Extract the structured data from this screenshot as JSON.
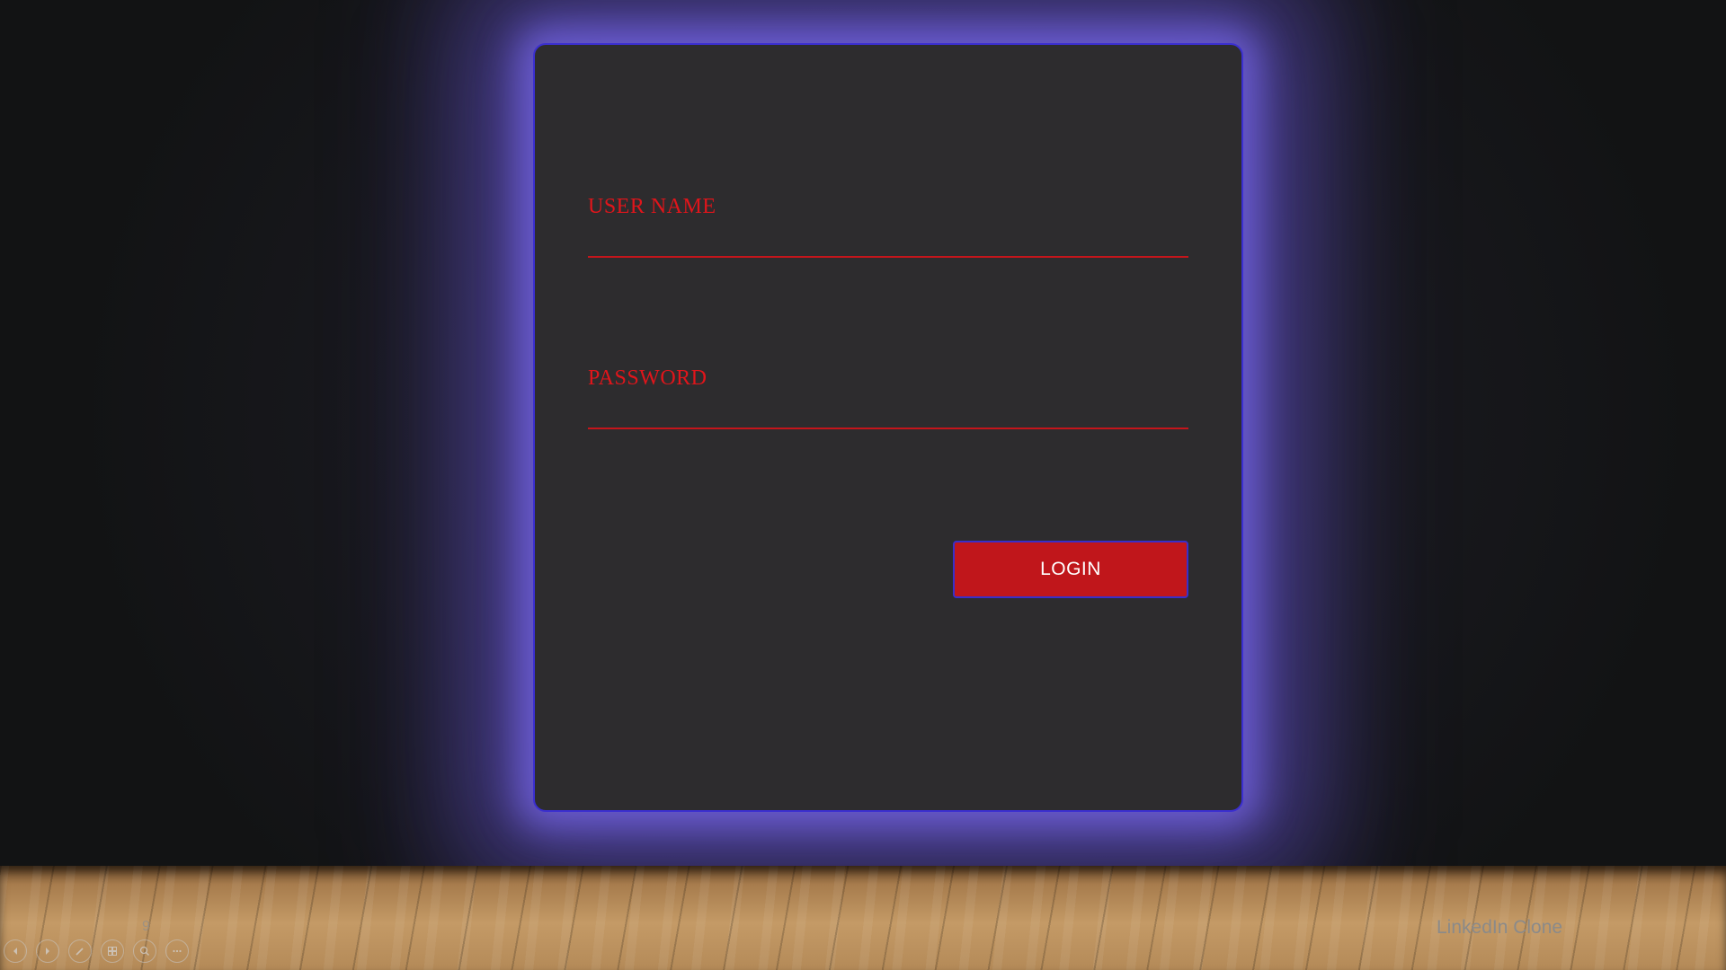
{
  "form": {
    "username_label": "USER NAME",
    "username_value": "",
    "password_label": "PASSWORD",
    "password_value": "",
    "login_label": "LOGIN"
  },
  "slide": {
    "number": "9",
    "footer_title": "LinkedIn Clone"
  },
  "controls": [
    {
      "name": "previous-slide",
      "icon": "chevron-left-icon"
    },
    {
      "name": "next-slide",
      "icon": "chevron-right-icon"
    },
    {
      "name": "pen-tool",
      "icon": "pen-icon"
    },
    {
      "name": "slide-sorter",
      "icon": "grid-icon"
    },
    {
      "name": "zoom",
      "icon": "magnifier-icon"
    },
    {
      "name": "more-options",
      "icon": "ellipsis-icon"
    }
  ],
  "colors": {
    "card_bg": "#2d2c2e",
    "glow": "#6a5ad8",
    "label_red": "#e0151b",
    "button_red": "#c0161b",
    "border_blue": "#3b2fd0"
  }
}
